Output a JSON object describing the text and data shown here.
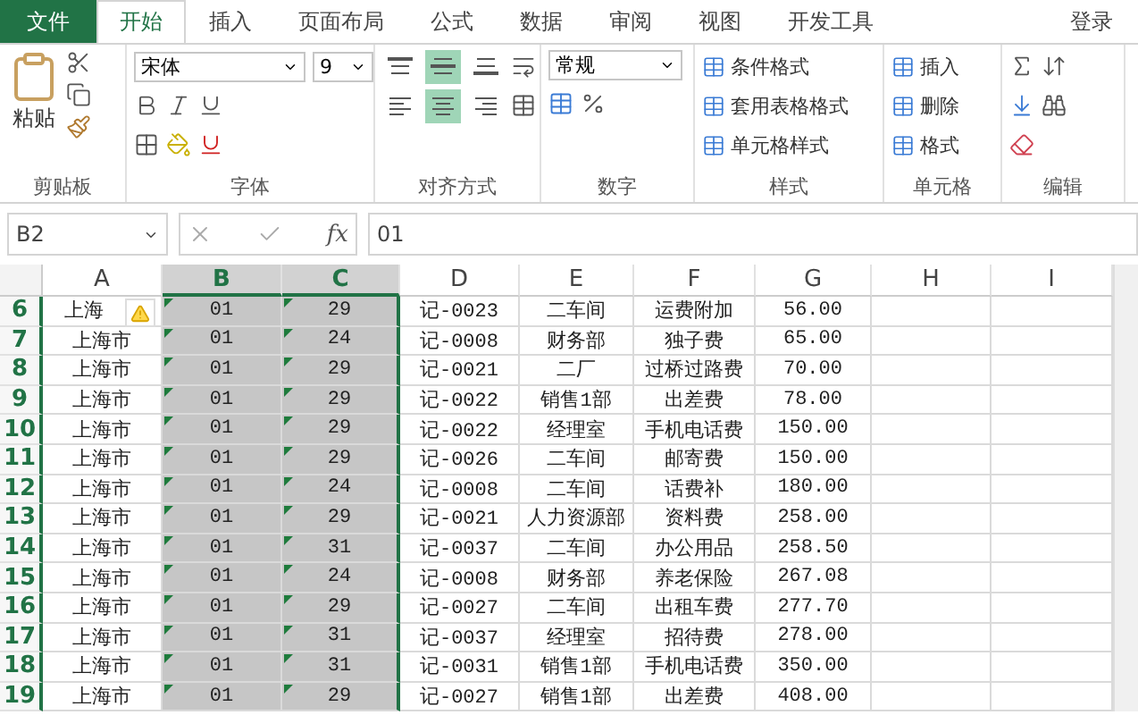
{
  "tabs": [
    {
      "label": "文件",
      "kind": "file",
      "selected": false
    },
    {
      "label": "开始",
      "kind": "tab",
      "selected": true
    },
    {
      "label": "插入",
      "kind": "tab",
      "selected": false
    },
    {
      "label": "页面布局",
      "kind": "tab",
      "selected": false
    },
    {
      "label": "公式",
      "kind": "tab",
      "selected": false
    },
    {
      "label": "数据",
      "kind": "tab",
      "selected": false
    },
    {
      "label": "审阅",
      "kind": "tab",
      "selected": false
    },
    {
      "label": "视图",
      "kind": "tab",
      "selected": false
    },
    {
      "label": "开发工具",
      "kind": "tab",
      "selected": false
    }
  ],
  "login": "登录",
  "ribbon": {
    "clipboard": {
      "paste": "粘贴",
      "label": "剪贴板"
    },
    "font": {
      "font_name": "宋体",
      "font_size": "9",
      "label": "字体"
    },
    "alignment": {
      "label": "对齐方式",
      "buttons": [
        {
          "kind": "top",
          "selected": false
        },
        {
          "kind": "middle",
          "selected": true
        },
        {
          "kind": "bottom",
          "selected": false
        },
        {
          "kind": "left",
          "selected": false
        },
        {
          "kind": "center",
          "selected": true
        },
        {
          "kind": "right",
          "selected": false
        }
      ]
    },
    "number": {
      "format": "常规",
      "label": "数字"
    },
    "styles": {
      "buttons": [
        "条件格式",
        "套用表格格式",
        "单元格样式"
      ],
      "label": "样式"
    },
    "cells": {
      "buttons": [
        "插入",
        "删除",
        "格式"
      ],
      "label": "单元格"
    },
    "editing": {
      "label": "编辑"
    }
  },
  "formula_bar": {
    "name_box": "B2",
    "fx": "fx",
    "value": "01"
  },
  "columns": [
    {
      "label": "A",
      "selected": false,
      "flag": false
    },
    {
      "label": "B",
      "selected": true,
      "flag": true
    },
    {
      "label": "C",
      "selected": true,
      "flag": true
    },
    {
      "label": "D",
      "selected": false,
      "flag": false
    },
    {
      "label": "E",
      "selected": false,
      "flag": false
    },
    {
      "label": "F",
      "selected": false,
      "flag": false
    },
    {
      "label": "G",
      "selected": false,
      "flag": false
    },
    {
      "label": "H",
      "selected": false,
      "flag": false
    },
    {
      "label": "I",
      "selected": false,
      "flag": false
    }
  ],
  "rows": [
    {
      "number": "6",
      "warning": true,
      "cells": [
        "上海",
        "01",
        "29",
        "记-0023",
        "二车间",
        "运费附加",
        "56.00"
      ]
    },
    {
      "number": "7",
      "warning": false,
      "cells": [
        "上海市",
        "01",
        "24",
        "记-0008",
        "财务部",
        "独子费",
        "65.00"
      ]
    },
    {
      "number": "8",
      "warning": false,
      "cells": [
        "上海市",
        "01",
        "29",
        "记-0021",
        "二厂",
        "过桥过路费",
        "70.00"
      ]
    },
    {
      "number": "9",
      "warning": false,
      "cells": [
        "上海市",
        "01",
        "29",
        "记-0022",
        "销售1部",
        "出差费",
        "78.00"
      ]
    },
    {
      "number": "10",
      "warning": false,
      "cells": [
        "上海市",
        "01",
        "29",
        "记-0022",
        "经理室",
        "手机电话费",
        "150.00"
      ]
    },
    {
      "number": "11",
      "warning": false,
      "cells": [
        "上海市",
        "01",
        "29",
        "记-0026",
        "二车间",
        "邮寄费",
        "150.00"
      ]
    },
    {
      "number": "12",
      "warning": false,
      "cells": [
        "上海市",
        "01",
        "24",
        "记-0008",
        "二车间",
        "话费补",
        "180.00"
      ]
    },
    {
      "number": "13",
      "warning": false,
      "cells": [
        "上海市",
        "01",
        "29",
        "记-0021",
        "人力资源部",
        "资料费",
        "258.00"
      ]
    },
    {
      "number": "14",
      "warning": false,
      "cells": [
        "上海市",
        "01",
        "31",
        "记-0037",
        "二车间",
        "办公用品",
        "258.50"
      ]
    },
    {
      "number": "15",
      "warning": false,
      "cells": [
        "上海市",
        "01",
        "24",
        "记-0008",
        "财务部",
        "养老保险",
        "267.08"
      ]
    },
    {
      "number": "16",
      "warning": false,
      "cells": [
        "上海市",
        "01",
        "29",
        "记-0027",
        "二车间",
        "出租车费",
        "277.70"
      ]
    },
    {
      "number": "17",
      "warning": false,
      "cells": [
        "上海市",
        "01",
        "31",
        "记-0037",
        "经理室",
        "招待费",
        "278.00"
      ]
    },
    {
      "number": "18",
      "warning": false,
      "cells": [
        "上海市",
        "01",
        "31",
        "记-0031",
        "销售1部",
        "手机电话费",
        "350.00"
      ]
    },
    {
      "number": "19",
      "warning": false,
      "cells": [
        "上海市",
        "01",
        "29",
        "记-0027",
        "销售1部",
        "出差费",
        "408.00"
      ]
    }
  ]
}
